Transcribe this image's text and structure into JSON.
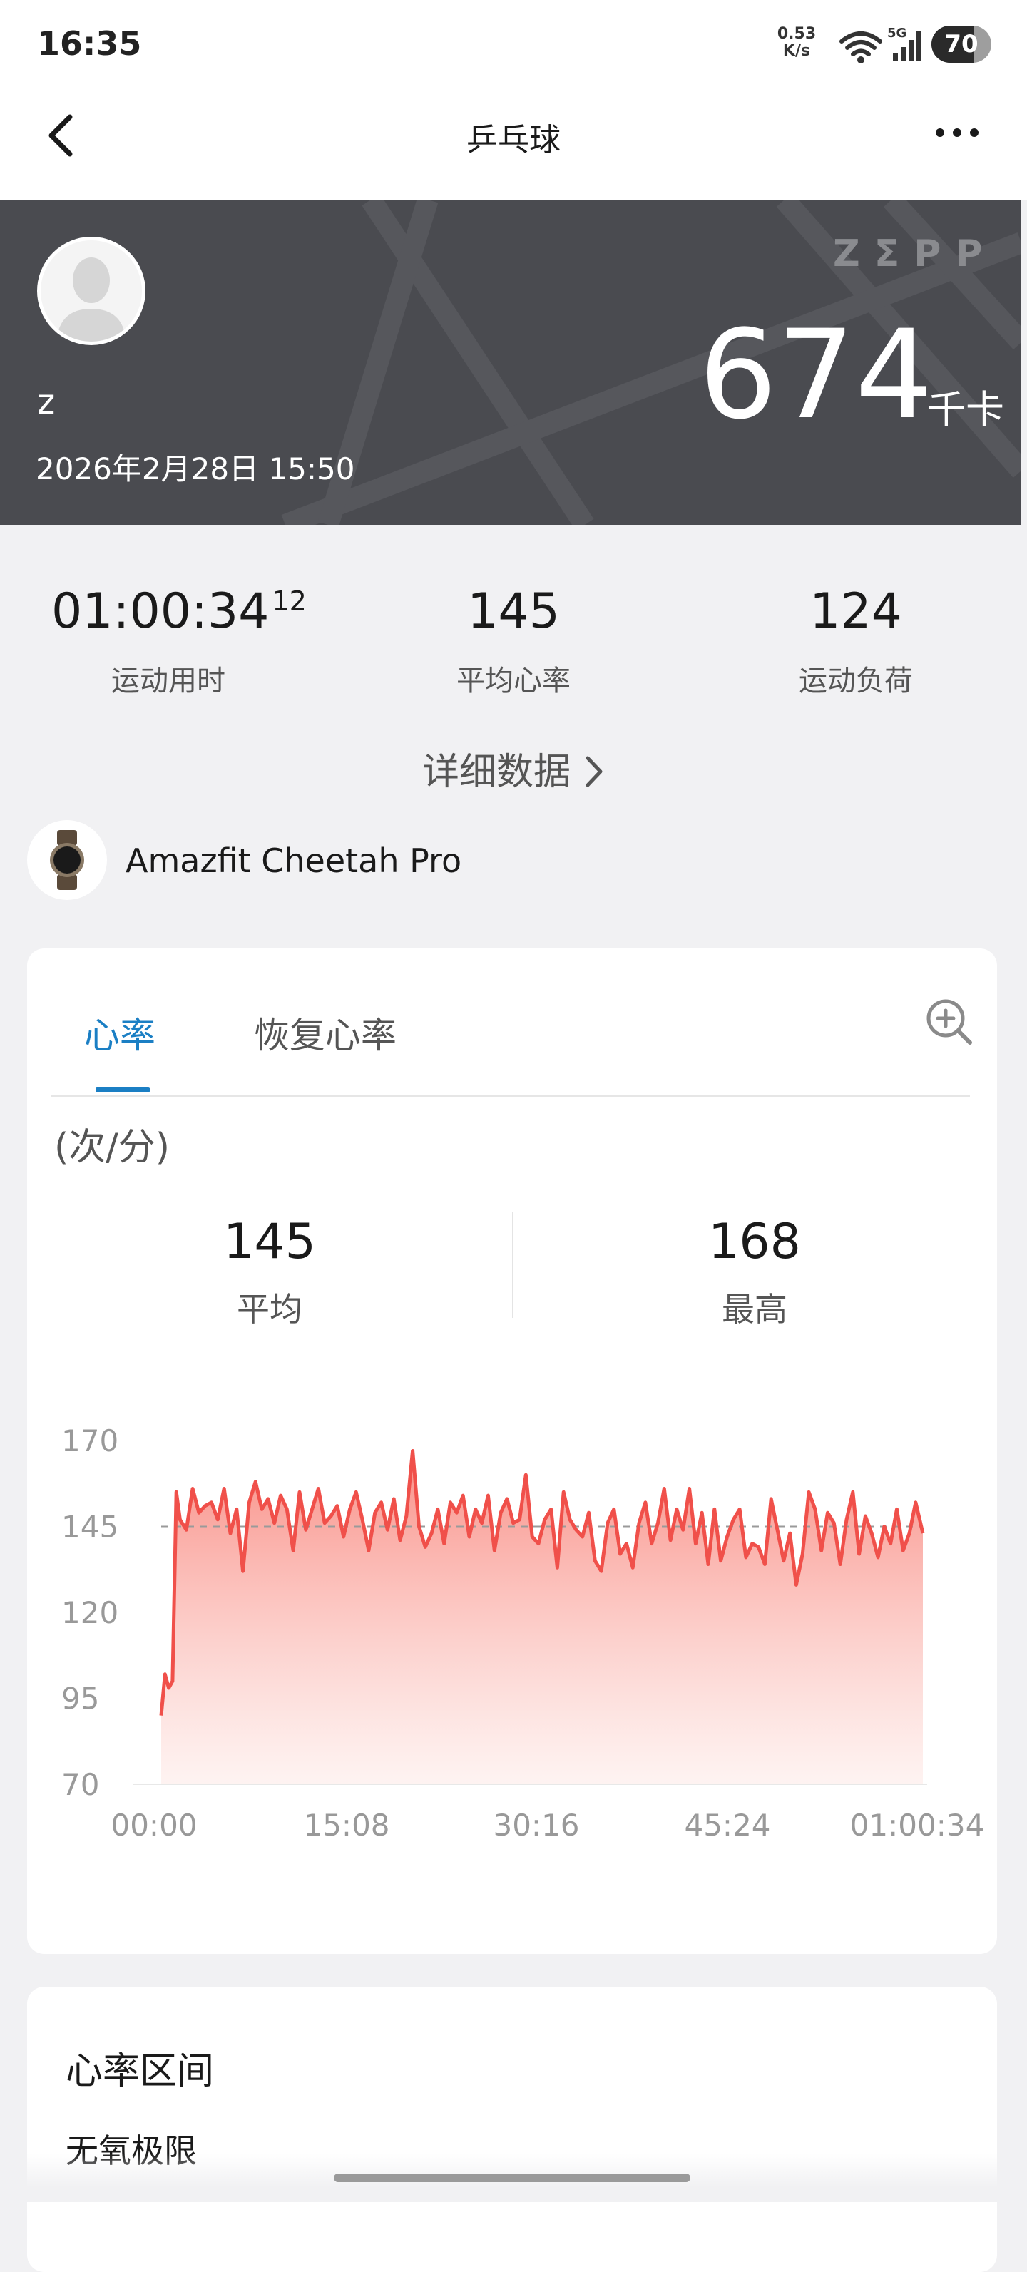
{
  "status_bar": {
    "time": "16:35",
    "net_speed_value": "0.53",
    "net_speed_unit": "K/s",
    "signal_label": "5G",
    "battery": "70",
    "battery_level_percent": 70,
    "wifi_icon": "wifi-icon",
    "signal_icon": "signal-bars-icon"
  },
  "header": {
    "title": "乒乓球",
    "back_icon": "chevron-left-icon",
    "more_icon": "more-horizontal-icon"
  },
  "banner": {
    "user_name": "z",
    "date": "2026年2月28日 15:50",
    "brand": "ZΣPP",
    "calories_value": "674",
    "calories_unit": "千卡",
    "background_color": "#4a4b50"
  },
  "stats": {
    "duration_main": "01:00:34",
    "duration_fraction": "12",
    "duration_label": "运动用时",
    "avg_hr": "145",
    "avg_hr_label": "平均心率",
    "load": "124",
    "load_label": "运动负荷"
  },
  "details_link": "详细数据",
  "device": {
    "name": "Amazfit Cheetah Pro",
    "icon": "watch-icon"
  },
  "hr_card": {
    "tabs": [
      {
        "label": "心率",
        "active": true
      },
      {
        "label": "恢复心率",
        "active": false
      }
    ],
    "zoom_icon": "zoom-in-icon",
    "unit": "(次/分)",
    "avg_value": "145",
    "avg_label": "平均",
    "max_value": "168",
    "max_label": "最高",
    "accent_color": "#1b7fc4",
    "line_color": "#f0504a"
  },
  "chart_data": {
    "type": "area",
    "title": "",
    "xlabel": "",
    "ylabel": "(次/分)",
    "x_ticks": [
      "00:00",
      "15:08",
      "30:16",
      "45:24",
      "01:00:34"
    ],
    "y_ticks": [
      170,
      145,
      120,
      95,
      70
    ],
    "ylim": [
      70,
      170
    ],
    "x_range_minutes": [
      0,
      60.57
    ],
    "average_line": 145,
    "grid": false,
    "series": [
      {
        "x": [
          0,
          0.3,
          0.6,
          0.9,
          1.2,
          1.5,
          2.0,
          2.5,
          3.0,
          3.5,
          4.0,
          4.5,
          5.0,
          5.5,
          6.0,
          6.5,
          7.0,
          7.5,
          8.0,
          8.5,
          9.0,
          9.5,
          10.0,
          10.5,
          11.0,
          11.5,
          12.0,
          12.5,
          13.0,
          13.5,
          14.0,
          14.5,
          15.0,
          15.5,
          16.0,
          16.5,
          17.0,
          17.5,
          18.0,
          18.5,
          19.0,
          19.5,
          20.0,
          20.5,
          21.0,
          21.5,
          22.0,
          22.5,
          23.0,
          23.5,
          24.0,
          24.5,
          25.0,
          25.5,
          26.0,
          26.5,
          27.0,
          27.5,
          28.0,
          28.5,
          29.0,
          29.5,
          30.0,
          30.5,
          31.0,
          31.5,
          32.0,
          32.5,
          33.0,
          33.5,
          34.0,
          34.5,
          35.0,
          35.5,
          36.0,
          36.5,
          37.0,
          37.5,
          38.0,
          38.5,
          39.0,
          39.5,
          40.0,
          40.5,
          41.0,
          41.5,
          42.0,
          42.5,
          43.0,
          43.5,
          44.0,
          44.5,
          45.0,
          45.5,
          46.0,
          46.5,
          47.0,
          47.5,
          48.0,
          48.5,
          49.0,
          49.5,
          50.0,
          50.5,
          51.0,
          51.5,
          52.0,
          52.5,
          53.0,
          53.5,
          54.0,
          54.5,
          55.0,
          55.5,
          56.0,
          56.5,
          57.0,
          57.5,
          58.0,
          58.5,
          59.0,
          59.5,
          60.0,
          60.57
        ],
        "values": [
          90,
          102,
          98,
          100,
          155,
          147,
          144,
          156,
          149,
          151,
          152,
          147,
          156,
          143,
          150,
          132,
          152,
          158,
          150,
          153,
          146,
          154,
          150,
          138,
          155,
          144,
          150,
          156,
          146,
          148,
          151,
          142,
          150,
          155,
          147,
          138,
          149,
          152,
          144,
          153,
          141,
          148,
          167,
          145,
          139,
          143,
          150,
          140,
          152,
          149,
          154,
          142,
          150,
          146,
          154,
          138,
          149,
          153,
          146,
          147,
          160,
          142,
          140,
          147,
          150,
          133,
          155,
          147,
          144,
          142,
          149,
          135,
          132,
          146,
          150,
          137,
          140,
          133,
          146,
          152,
          140,
          146,
          156,
          141,
          150,
          144,
          156,
          140,
          149,
          134,
          150,
          135,
          142,
          147,
          150,
          136,
          140,
          139,
          134,
          153,
          144,
          135,
          143,
          128,
          137,
          155,
          150,
          138,
          149,
          146,
          134,
          147,
          155,
          137,
          148,
          143,
          136,
          145,
          140,
          150,
          138,
          143,
          152,
          143
        ]
      }
    ]
  },
  "zones_card": {
    "title": "心率区间",
    "first_zone": "无氧极限"
  }
}
